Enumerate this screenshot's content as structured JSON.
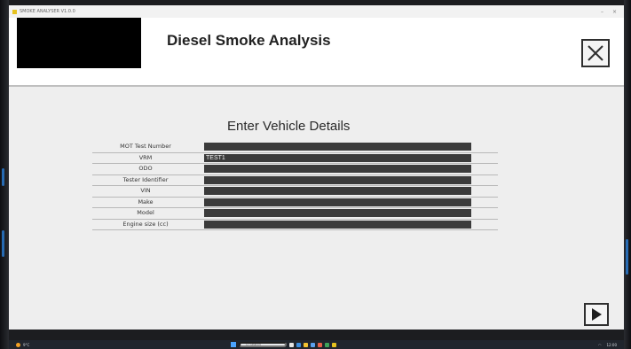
{
  "window": {
    "title": "SMOKE ANALYSER V1.0.0",
    "controls": {
      "minimize": "–",
      "close": "×"
    }
  },
  "header": {
    "title": "Diesel Smoke Analysis",
    "close_icon": "close-icon"
  },
  "form": {
    "title": "Enter Vehicle Details",
    "fields": [
      {
        "label": "MOT Test Number",
        "value": ""
      },
      {
        "label": "VRM",
        "value": "TEST1"
      },
      {
        "label": "ODO",
        "value": ""
      },
      {
        "label": "Tester Identifier",
        "value": ""
      },
      {
        "label": "VIN",
        "value": ""
      },
      {
        "label": "Make",
        "value": ""
      },
      {
        "label": "Model",
        "value": ""
      },
      {
        "label": "Engine size (cc)",
        "value": ""
      }
    ]
  },
  "navigation": {
    "next_icon": "play-arrow-icon"
  },
  "taskbar": {
    "weather": "9°C",
    "search_placeholder": "Q Search",
    "tray_time": "12:00"
  },
  "colors": {
    "field_bg": "#3b3b3b",
    "content_bg": "#eeeeee",
    "header_bg": "#ffffff",
    "logo_bg": "#000000"
  }
}
